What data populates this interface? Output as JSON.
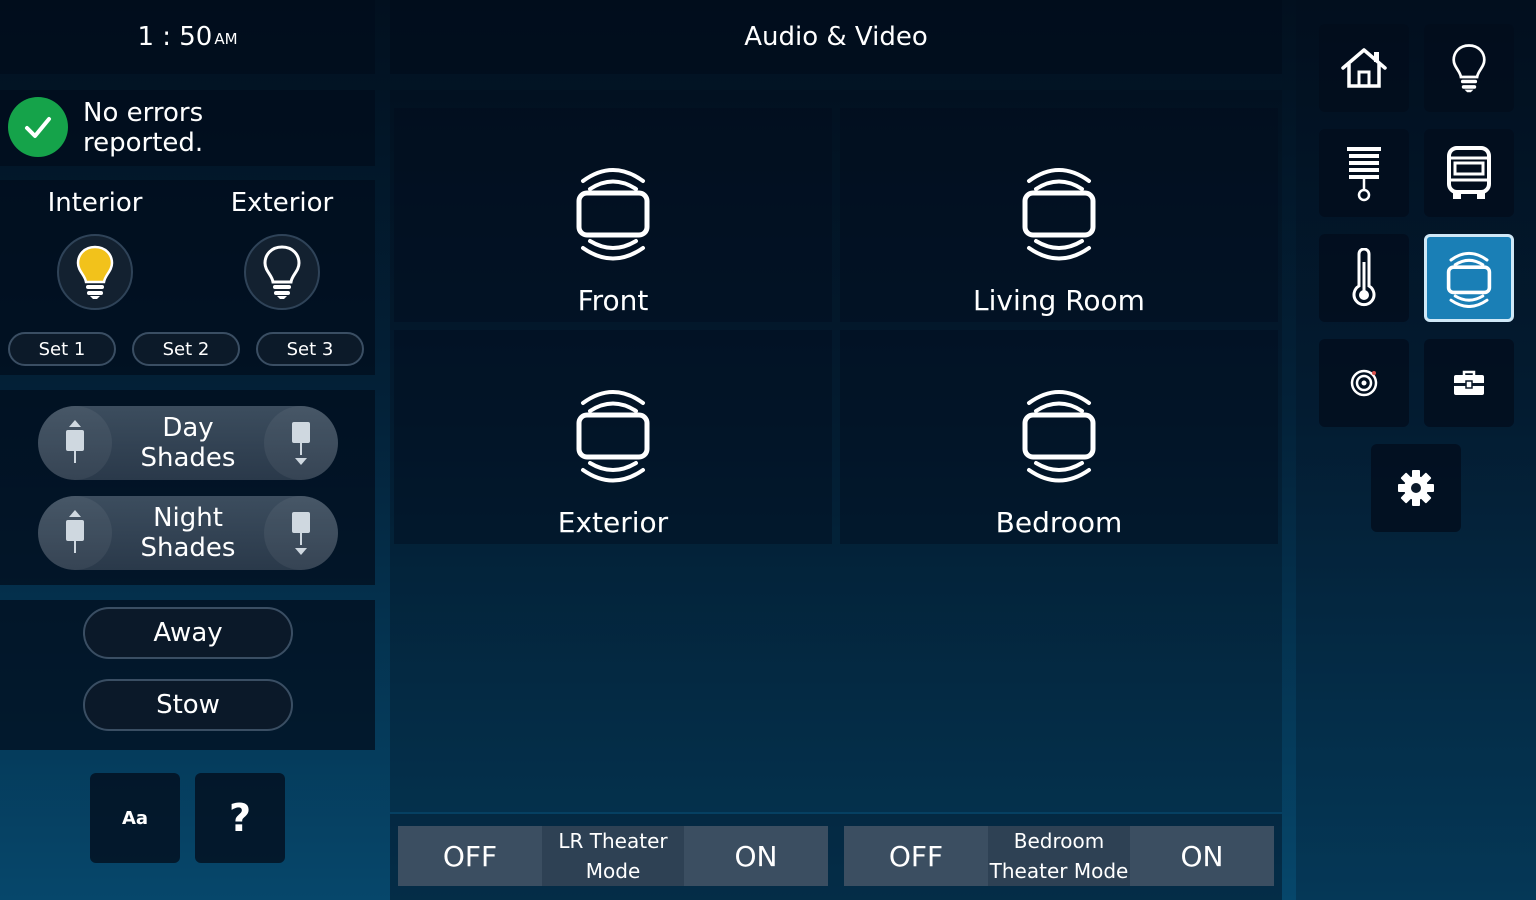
{
  "clock": {
    "time": "1 : 50",
    "ampm": "AM"
  },
  "status": {
    "message_line1": "No errors",
    "message_line2": "reported.",
    "color": "#15a34a"
  },
  "lights": {
    "interior_label": "Interior",
    "exterior_label": "Exterior",
    "interior_bulb_color": "#f2c21b",
    "sets": [
      "Set 1",
      "Set 2",
      "Set 3"
    ]
  },
  "shades": {
    "day": {
      "line1": "Day",
      "line2": "Shades"
    },
    "night": {
      "line1": "Night",
      "line2": "Shades"
    }
  },
  "modes": {
    "away": "Away",
    "stow": "Stow"
  },
  "utility": {
    "font_size_label": "Aa",
    "help_label": "?"
  },
  "header": {
    "title": "Audio & Video"
  },
  "rooms": [
    {
      "label": "Front"
    },
    {
      "label": "Living Room"
    },
    {
      "label": "Exterior"
    },
    {
      "label": "Bedroom"
    }
  ],
  "theater": {
    "lr": {
      "off": "OFF",
      "label_line1": "LR Theater",
      "label_line2": "Mode",
      "on": "ON"
    },
    "bedroom": {
      "off": "OFF",
      "label_line1": "Bedroom",
      "label_line2": "Theater Mode",
      "on": "ON"
    }
  },
  "nav": {
    "items": [
      "home-icon",
      "lightbulb-icon",
      "shade-icon",
      "rv-icon",
      "thermometer-icon",
      "audio-video-icon",
      "target-icon",
      "toolbox-icon",
      "gear-icon"
    ],
    "active": "audio-video-icon",
    "active_color": "#1a7fb6"
  }
}
